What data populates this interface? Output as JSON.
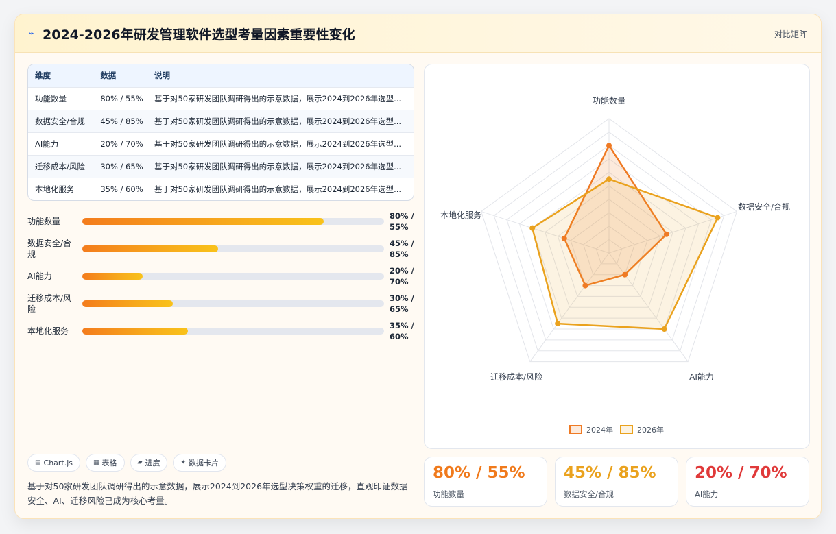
{
  "header": {
    "icon": "sparkle-icon",
    "title": "2024-2026年研发管理软件选型考量因素重要性变化",
    "tag": "对比矩阵"
  },
  "table": {
    "headers": [
      "维度",
      "数据",
      "说明"
    ],
    "rows": [
      {
        "dim": "功能数量",
        "data": "80% / 55%",
        "desc": "基于对50家研发团队调研得出的示意数据，展示2024到2026年选型..."
      },
      {
        "dim": "数据安全/合规",
        "data": "45% / 85%",
        "desc": "基于对50家研发团队调研得出的示意数据，展示2024到2026年选型..."
      },
      {
        "dim": "AI能力",
        "data": "20% / 70%",
        "desc": "基于对50家研发团队调研得出的示意数据，展示2024到2026年选型..."
      },
      {
        "dim": "迁移成本/风险",
        "data": "30% / 65%",
        "desc": "基于对50家研发团队调研得出的示意数据，展示2024到2026年选型..."
      },
      {
        "dim": "本地化服务",
        "data": "35% / 60%",
        "desc": "基于对50家研发团队调研得出的示意数据，展示2024到2026年选型..."
      }
    ]
  },
  "bars": [
    {
      "label": "功能数量",
      "value_text": "80% / 55%",
      "fill": 80
    },
    {
      "label": "数据安全/合规",
      "value_text": "45% / 85%",
      "fill": 45
    },
    {
      "label": "AI能力",
      "value_text": "20% / 70%",
      "fill": 20
    },
    {
      "label": "迁移成本/风险",
      "value_text": "30% / 65%",
      "fill": 30
    },
    {
      "label": "本地化服务",
      "value_text": "35% / 60%",
      "fill": 35
    }
  ],
  "tags": [
    {
      "icon": "chart-icon",
      "glyph": "▤",
      "label": "Chart.js"
    },
    {
      "icon": "table-icon",
      "glyph": "▦",
      "label": "表格"
    },
    {
      "icon": "progress-icon",
      "glyph": "▰",
      "label": "进度"
    },
    {
      "icon": "card-icon",
      "glyph": "✦",
      "label": "数据卡片"
    }
  ],
  "footer_text": "基于对50家研发团队调研得出的示意数据，展示2024到2026年选型决策权重的迁移，直观印证数据安全、AI、迁移风险已成为核心考量。",
  "stats": [
    {
      "value": "80% / 55%",
      "label": "功能数量",
      "color": "#f07a1c"
    },
    {
      "value": "45% / 85%",
      "label": "数据安全/合规",
      "color": "#eaa21e"
    },
    {
      "value": "20% / 70%",
      "label": "AI能力",
      "color": "#e03a3a"
    }
  ],
  "colors": {
    "series_2024": "#ef7a24",
    "series_2026": "#eaa21e"
  },
  "chart_data": {
    "type": "radar",
    "categories": [
      "功能数量",
      "数据安全/合规",
      "AI能力",
      "迁移成本/风险",
      "本地化服务"
    ],
    "series": [
      {
        "name": "2024年",
        "values": [
          80,
          45,
          20,
          30,
          35
        ]
      },
      {
        "name": "2026年",
        "values": [
          55,
          85,
          70,
          65,
          60
        ]
      }
    ],
    "rlim": [
      0,
      100
    ],
    "grid": true,
    "legend": "bottom"
  }
}
